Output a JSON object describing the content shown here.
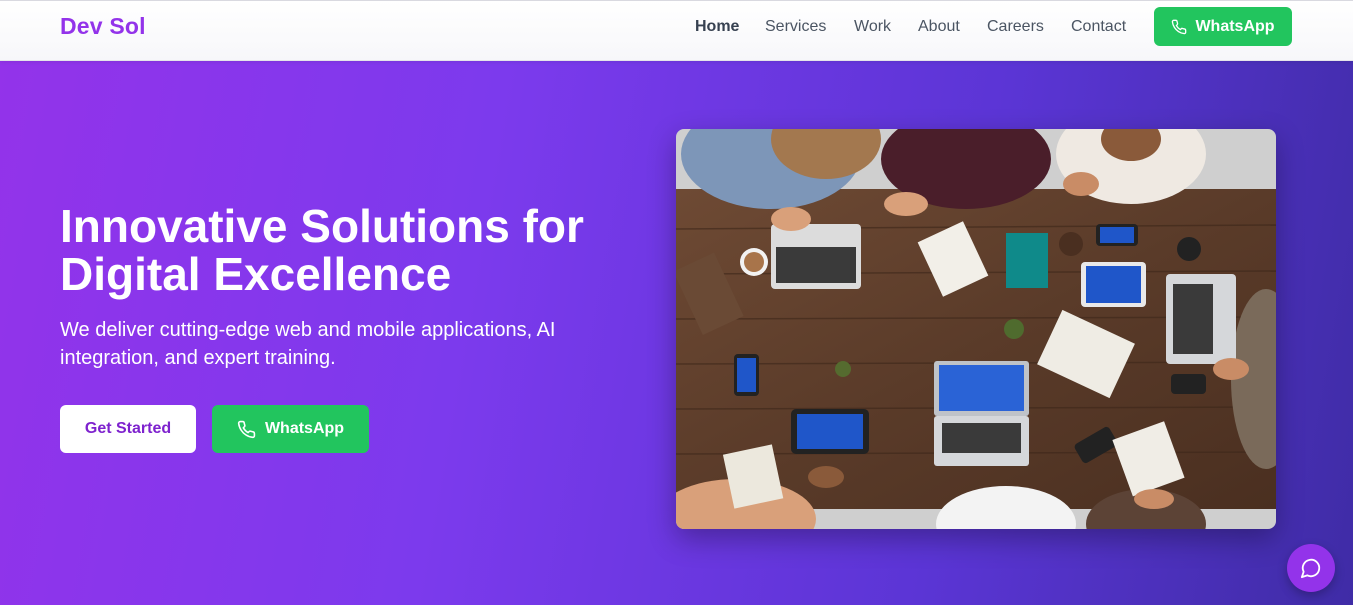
{
  "header": {
    "brand": "Dev Sol",
    "nav": [
      {
        "label": "Home",
        "active": true
      },
      {
        "label": "Services",
        "active": false
      },
      {
        "label": "Work",
        "active": false
      },
      {
        "label": "About",
        "active": false
      },
      {
        "label": "Careers",
        "active": false
      },
      {
        "label": "Contact",
        "active": false
      }
    ],
    "whatsapp_label": "WhatsApp"
  },
  "hero": {
    "title_line1": "Innovative Solutions for",
    "title_line2": "Digital Excellence",
    "subtitle": "We deliver cutting-edge web and mobile applications, AI integration, and expert training.",
    "cta_primary": "Get Started",
    "cta_whatsapp": "WhatsApp"
  },
  "colors": {
    "brand": "#9333ea",
    "whatsapp": "#22c55e",
    "hero_gradient_start": "#9333ea",
    "hero_gradient_end": "#3f2ca6"
  },
  "icons": {
    "whatsapp": "phone-icon",
    "chat": "chat-bubble-icon"
  }
}
